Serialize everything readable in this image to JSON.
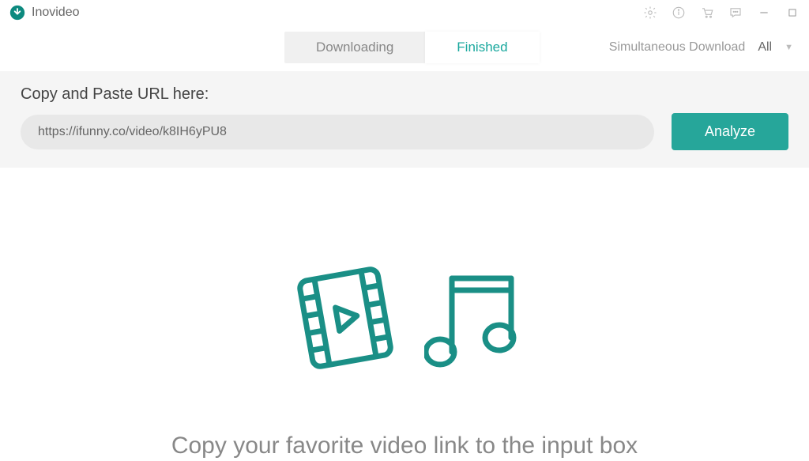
{
  "app": {
    "title": "Inovideo"
  },
  "tabs": {
    "downloading": "Downloading",
    "finished": "Finished"
  },
  "simultaneous": {
    "label": "Simultaneous Download",
    "value": "All"
  },
  "url_section": {
    "label": "Copy and Paste URL here:",
    "input_value": "https://ifunny.co/video/k8IH6yPU8",
    "analyze_button": "Analyze"
  },
  "empty_state": {
    "hint": "Copy your favorite video link to the input box"
  },
  "colors": {
    "accent": "#26a69a"
  }
}
